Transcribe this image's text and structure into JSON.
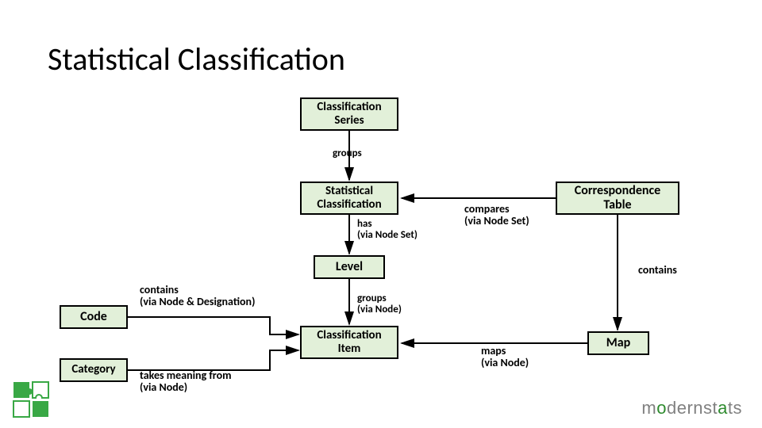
{
  "title": "Statistical Classification",
  "boxes": {
    "series": "Classification\nSeries",
    "statclass": "Statistical\nClassification",
    "corr": "Correspondence\nTable",
    "level": "Level",
    "code": "Code",
    "category": "Category",
    "clsitem": "Classification\nItem",
    "map": "Map"
  },
  "labels": {
    "groups1": "groups",
    "has": "has\n(via Node Set)",
    "compares": "compares\n(via Node Set)",
    "contains_right": "contains",
    "contains_left": "contains\n(via Node & Designation)",
    "groups2": "groups\n(via Node)",
    "maps": "maps\n(via Node)",
    "takes": "takes meaning from\n(via Node)"
  },
  "brand": {
    "m1": "m",
    "m2": "o",
    "m3": "dernst",
    "m4": "a",
    "m5": "ts"
  }
}
